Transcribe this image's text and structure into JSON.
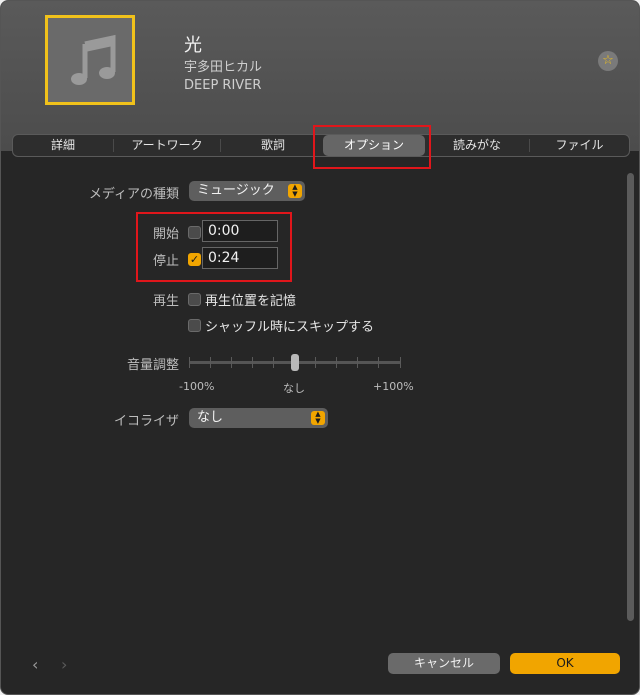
{
  "song": {
    "title": "光",
    "artist": "宇多田ヒカル",
    "album": "DEEP RIVER"
  },
  "header": {
    "star_icon": "☆"
  },
  "tabs": [
    {
      "label": "詳細"
    },
    {
      "label": "アートワーク"
    },
    {
      "label": "歌詞"
    },
    {
      "label": "オプション"
    },
    {
      "label": "読みがな"
    },
    {
      "label": "ファイル"
    }
  ],
  "options": {
    "media_kind_label": "メディアの種類",
    "media_kind_value": "ミュージック",
    "start_label": "開始",
    "start_value": "0:00",
    "start_checked": false,
    "stop_label": "停止",
    "stop_value": "0:24",
    "stop_checked": true,
    "playback_label": "再生",
    "remember_position": "再生位置を記憶",
    "skip_shuffle": "シャッフル時にスキップする",
    "volume_label": "音量調整",
    "volume_min": "-100%",
    "volume_mid": "なし",
    "volume_max": "+100%",
    "volume_value": 0,
    "eq_label": "イコライザ",
    "eq_value": "なし"
  },
  "footer": {
    "prev_icon": "‹",
    "next_icon": "›",
    "cancel": "キャンセル",
    "ok": "OK"
  },
  "colors": {
    "accent": "#f1a500",
    "highlight": "#e0161b",
    "artwork_border": "#f1c21b"
  }
}
